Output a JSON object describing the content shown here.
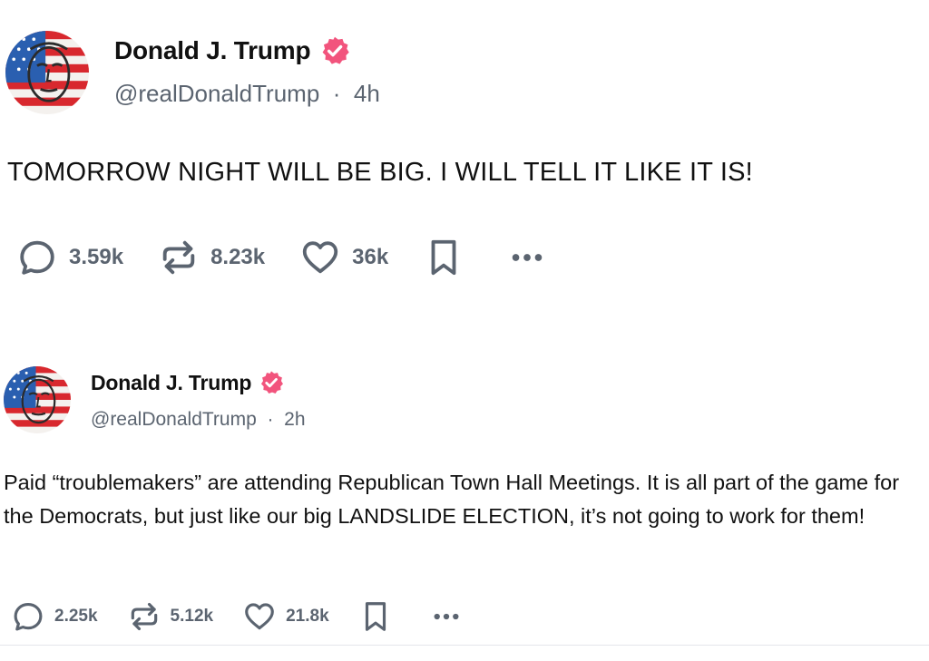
{
  "colors": {
    "verified_badge": "#f2547d",
    "text_primary": "#111111",
    "text_secondary": "#5b6470",
    "divider": "#e4e6ea"
  },
  "posts": [
    {
      "author": {
        "display_name": "Donald J. Trump",
        "handle": "@realDonaldTrump",
        "separator": "·",
        "time": "4h",
        "verified_icon": "verified-badge-icon",
        "avatar_icon": "profile-avatar"
      },
      "text": "TOMORROW NIGHT WILL BE BIG. I WILL TELL IT LIKE IT IS!",
      "actions": {
        "reply_count": "3.59k",
        "repost_count": "8.23k",
        "like_count": "36k",
        "reply_icon": "reply-icon",
        "repost_icon": "repost-icon",
        "like_icon": "heart-icon",
        "bookmark_icon": "bookmark-icon",
        "more_icon": "more-icon"
      }
    },
    {
      "author": {
        "display_name": "Donald J. Trump",
        "handle": "@realDonaldTrump",
        "separator": "·",
        "time": "2h",
        "verified_icon": "verified-badge-icon",
        "avatar_icon": "profile-avatar"
      },
      "text": "Paid “troublemakers” are attending Republican Town Hall Meetings. It is all part of the game for the Democrats, but just like our big LANDSLIDE ELECTION, it’s not going to work for them!",
      "actions": {
        "reply_count": "2.25k",
        "repost_count": "5.12k",
        "like_count": "21.8k",
        "reply_icon": "reply-icon",
        "repost_icon": "repost-icon",
        "like_icon": "heart-icon",
        "bookmark_icon": "bookmark-icon",
        "more_icon": "more-icon"
      }
    }
  ]
}
